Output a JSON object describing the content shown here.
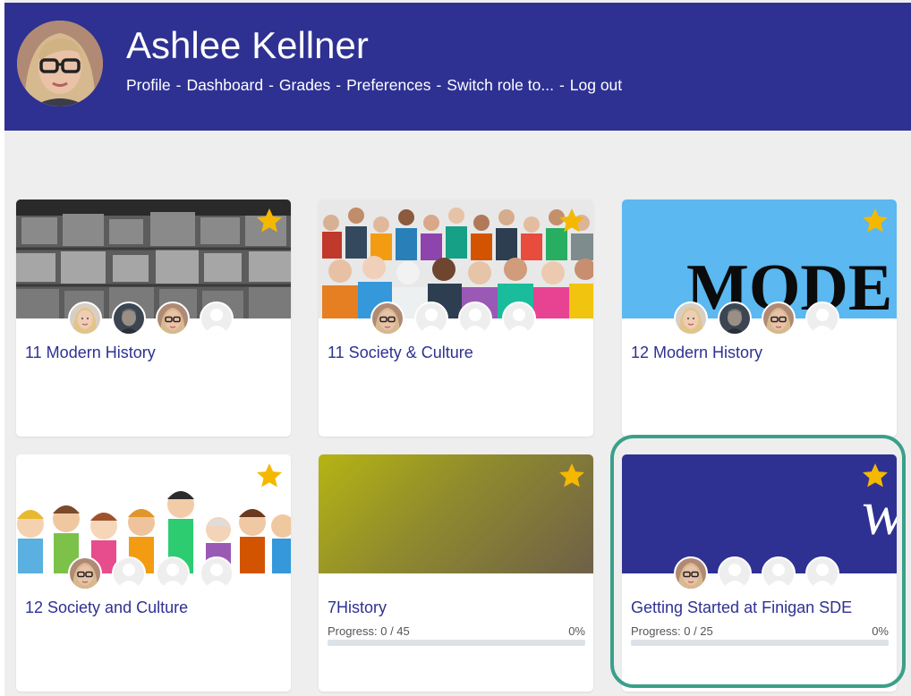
{
  "user": {
    "name": "Ashlee Kellner"
  },
  "nav": {
    "items": [
      {
        "label": "Profile"
      },
      {
        "label": "Dashboard"
      },
      {
        "label": "Grades"
      },
      {
        "label": "Preferences"
      },
      {
        "label": "Switch role to..."
      },
      {
        "label": "Log out"
      }
    ],
    "separator": "-"
  },
  "courses": [
    {
      "title": "11 Modern History",
      "starred": true,
      "image": "archive-shelves-photo"
    },
    {
      "title": "11 Society & Culture",
      "starred": true,
      "image": "crowd-of-people-photo"
    },
    {
      "title": "12 Modern History",
      "starred": true,
      "image": "modern-text-banner",
      "banner_text": "MODE"
    },
    {
      "title": "12 Society and Culture",
      "starred": true,
      "image": "cartoon-people-illustration"
    },
    {
      "title": "7History",
      "starred": true,
      "image": "olive-gradient",
      "progress_label": "Progress: 0 / 45",
      "progress_pct_label": "0%",
      "progress": 0
    },
    {
      "title": "Getting Started at Finigan SDE",
      "starred": true,
      "image": "navy-banner",
      "banner_text": "w",
      "progress_label": "Progress: 0 / 25",
      "progress_pct_label": "0%",
      "progress": 0
    }
  ],
  "colors": {
    "header": "#2e3192",
    "link": "#2e3192",
    "star": "#f5b800",
    "highlight": "#3aa089",
    "banner_blue": "#5bb8f0"
  }
}
